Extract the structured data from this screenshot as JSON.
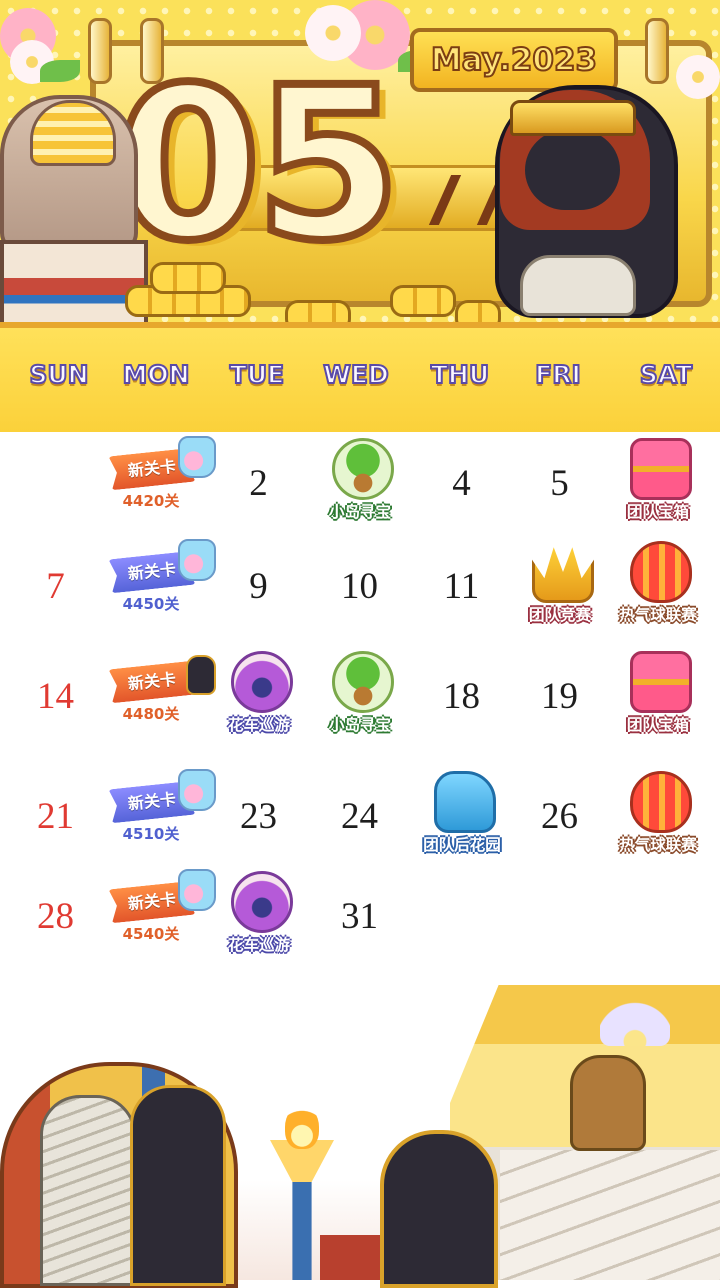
{
  "header": {
    "month_number": "05",
    "month_year": "May.2023",
    "weekdays": [
      "SUN",
      "MON",
      "TUE",
      "WED",
      "THU",
      "FRI",
      "SAT"
    ]
  },
  "calendar": {
    "days": [
      {
        "day": "",
        "event": {
          "type": "new-level",
          "label": "新关卡",
          "level": "4420关",
          "color": "orange",
          "icon": "candy-jar-icon"
        }
      },
      {
        "day": "2"
      },
      {
        "day": "",
        "event": {
          "type": "icon",
          "label": "小岛寻宝",
          "color": "green",
          "icon": "palm-island-icon"
        }
      },
      {
        "day": "4"
      },
      {
        "day": "5"
      },
      {
        "day": "",
        "event": {
          "type": "icon",
          "label": "团队宝箱",
          "color": "pink",
          "icon": "treasure-chest-icon"
        }
      },
      {
        "day": "7",
        "sunday": true
      },
      {
        "day": "",
        "event": {
          "type": "new-level",
          "label": "新关卡",
          "level": "4450关",
          "color": "blue",
          "icon": "candy-jar-icon"
        }
      },
      {
        "day": "9"
      },
      {
        "day": "10"
      },
      {
        "day": "11"
      },
      {
        "day": "",
        "event": {
          "type": "icon",
          "label": "团队竞赛",
          "color": "pink",
          "icon": "crown-icon"
        }
      },
      {
        "day": "",
        "event": {
          "type": "icon",
          "label": "热气球联赛",
          "color": "brown",
          "icon": "hot-air-balloon-icon"
        }
      },
      {
        "day": "14",
        "sunday": true
      },
      {
        "day": "",
        "event": {
          "type": "new-level",
          "label": "新关卡",
          "level": "4480关",
          "color": "orange",
          "icon": "black-cat-icon"
        }
      },
      {
        "day": "",
        "event": {
          "type": "icon",
          "label": "花车巡游",
          "color": "purple",
          "icon": "flower-float-icon"
        }
      },
      {
        "day": "",
        "event": {
          "type": "icon",
          "label": "小岛寻宝",
          "color": "green",
          "icon": "palm-island-icon"
        }
      },
      {
        "day": "18"
      },
      {
        "day": "19"
      },
      {
        "day": "",
        "event": {
          "type": "icon",
          "label": "团队宝箱",
          "color": "pink",
          "icon": "treasure-chest-icon"
        }
      },
      {
        "day": "21",
        "sunday": true
      },
      {
        "day": "",
        "event": {
          "type": "new-level",
          "label": "新关卡",
          "level": "4510关",
          "color": "blue",
          "icon": "candy-jar-icon"
        }
      },
      {
        "day": "23"
      },
      {
        "day": "24"
      },
      {
        "day": "",
        "event": {
          "type": "icon",
          "label": "团队后花园",
          "color": "blue",
          "icon": "watering-can-icon"
        }
      },
      {
        "day": "26"
      },
      {
        "day": "",
        "event": {
          "type": "icon",
          "label": "热气球联赛",
          "color": "brown",
          "icon": "hot-air-balloon-icon"
        }
      },
      {
        "day": "28",
        "sunday": true
      },
      {
        "day": "",
        "event": {
          "type": "new-level",
          "label": "新关卡",
          "level": "4540关",
          "color": "orange",
          "icon": "candy-jar-icon"
        }
      },
      {
        "day": "",
        "event": {
          "type": "icon",
          "label": "花车巡游",
          "color": "purple",
          "icon": "flower-float-icon"
        }
      },
      {
        "day": "31"
      }
    ]
  },
  "colors": {
    "sunday_red": "#e03a32",
    "header_yellow": "#fbe15a",
    "weekday_outline": "#5a4aa8",
    "ribbon_orange": "#e2552a",
    "ribbon_blue": "#5563d8"
  }
}
